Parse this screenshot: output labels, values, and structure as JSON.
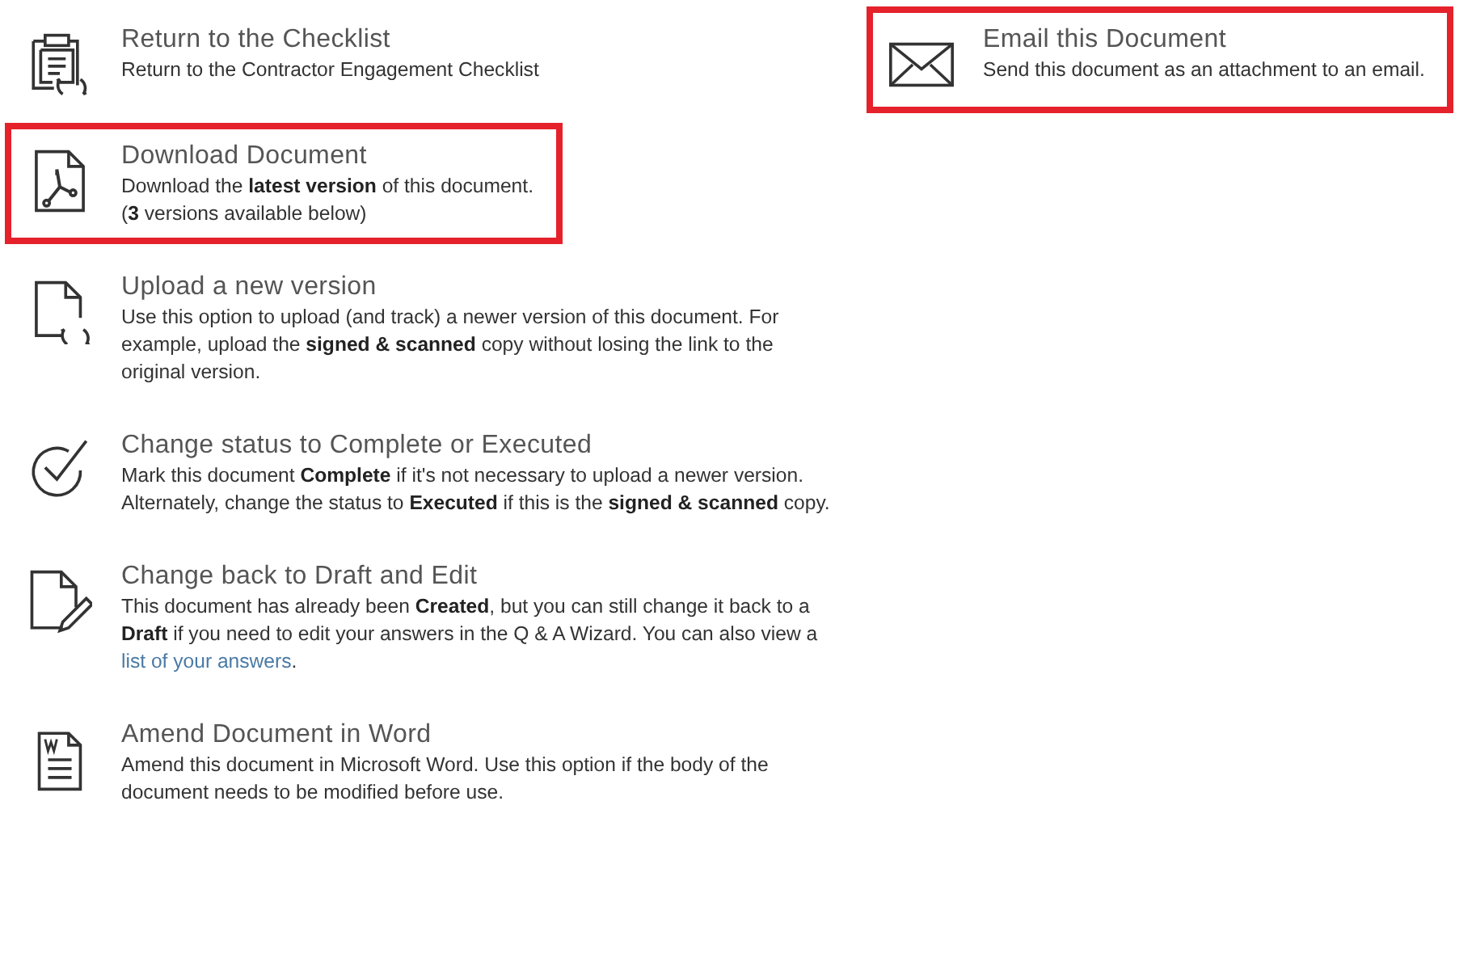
{
  "left_actions": [
    {
      "kind": "checklist",
      "title": "Return to the Checklist",
      "description": "Return to the Contractor Engagement Checklist",
      "highlighted": false
    },
    {
      "kind": "pdf",
      "title": "Download Document",
      "description": "Download the **latest version** of this document.\n(**3** versions available below)",
      "highlighted": true
    },
    {
      "kind": "upload",
      "title": "Upload a new version",
      "description": "Use this option to upload (and track) a newer version of this document. For example, upload the **signed & scanned** copy without losing the link to the original version.",
      "highlighted": false
    },
    {
      "kind": "check",
      "title": "Change status to Complete or Executed",
      "description": "Mark this document **Complete** if it's not necessary to upload a newer version. Alternately, change the status to **Executed** if this is the **signed & scanned** copy.",
      "highlighted": false
    },
    {
      "kind": "edit",
      "title": "Change back to Draft and Edit",
      "description": "This document has already been **Created**, but you can still change it back to a **Draft** if you need to edit your answers in the Q & A Wizard. You can also view a ",
      "link": "list of your answers",
      "after": ".",
      "highlighted": false
    },
    {
      "kind": "word",
      "title": "Amend Document in Word",
      "description": "Amend this document in Microsoft Word. Use this option if the body of the document needs to be modified before use.",
      "highlighted": false
    }
  ],
  "right_actions": [
    {
      "kind": "email",
      "title": "Email this Document",
      "description": "Send this document as an attachment to an email.",
      "highlighted": true
    }
  ]
}
